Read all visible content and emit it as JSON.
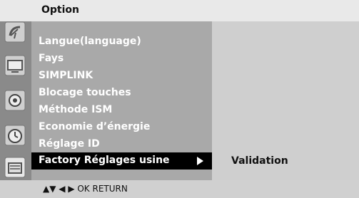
{
  "header": {
    "title": "Option"
  },
  "menu": {
    "items": [
      "Langue(language)",
      "Fays",
      "SIMPLINK",
      "Blocage touches",
      "Méthode ISM",
      "Economie d’énergie",
      "Réglage ID"
    ],
    "selected": {
      "label": "Factory Réglages usine",
      "arrow": "right-arrow-icon"
    }
  },
  "submenu": {
    "value": "Validation"
  },
  "footer": {
    "nav": "▲▼ ◀ ▶ OK RETURN"
  },
  "icons": [
    "satellite-dish-icon",
    "tv-screen-icon",
    "speaker-icon",
    "clock-icon",
    "option-settings-icon"
  ],
  "colors": {
    "selected_bg": "#000000",
    "menu_bg": "#a9a9a9",
    "iconbar_bg": "#8a8a8a"
  }
}
